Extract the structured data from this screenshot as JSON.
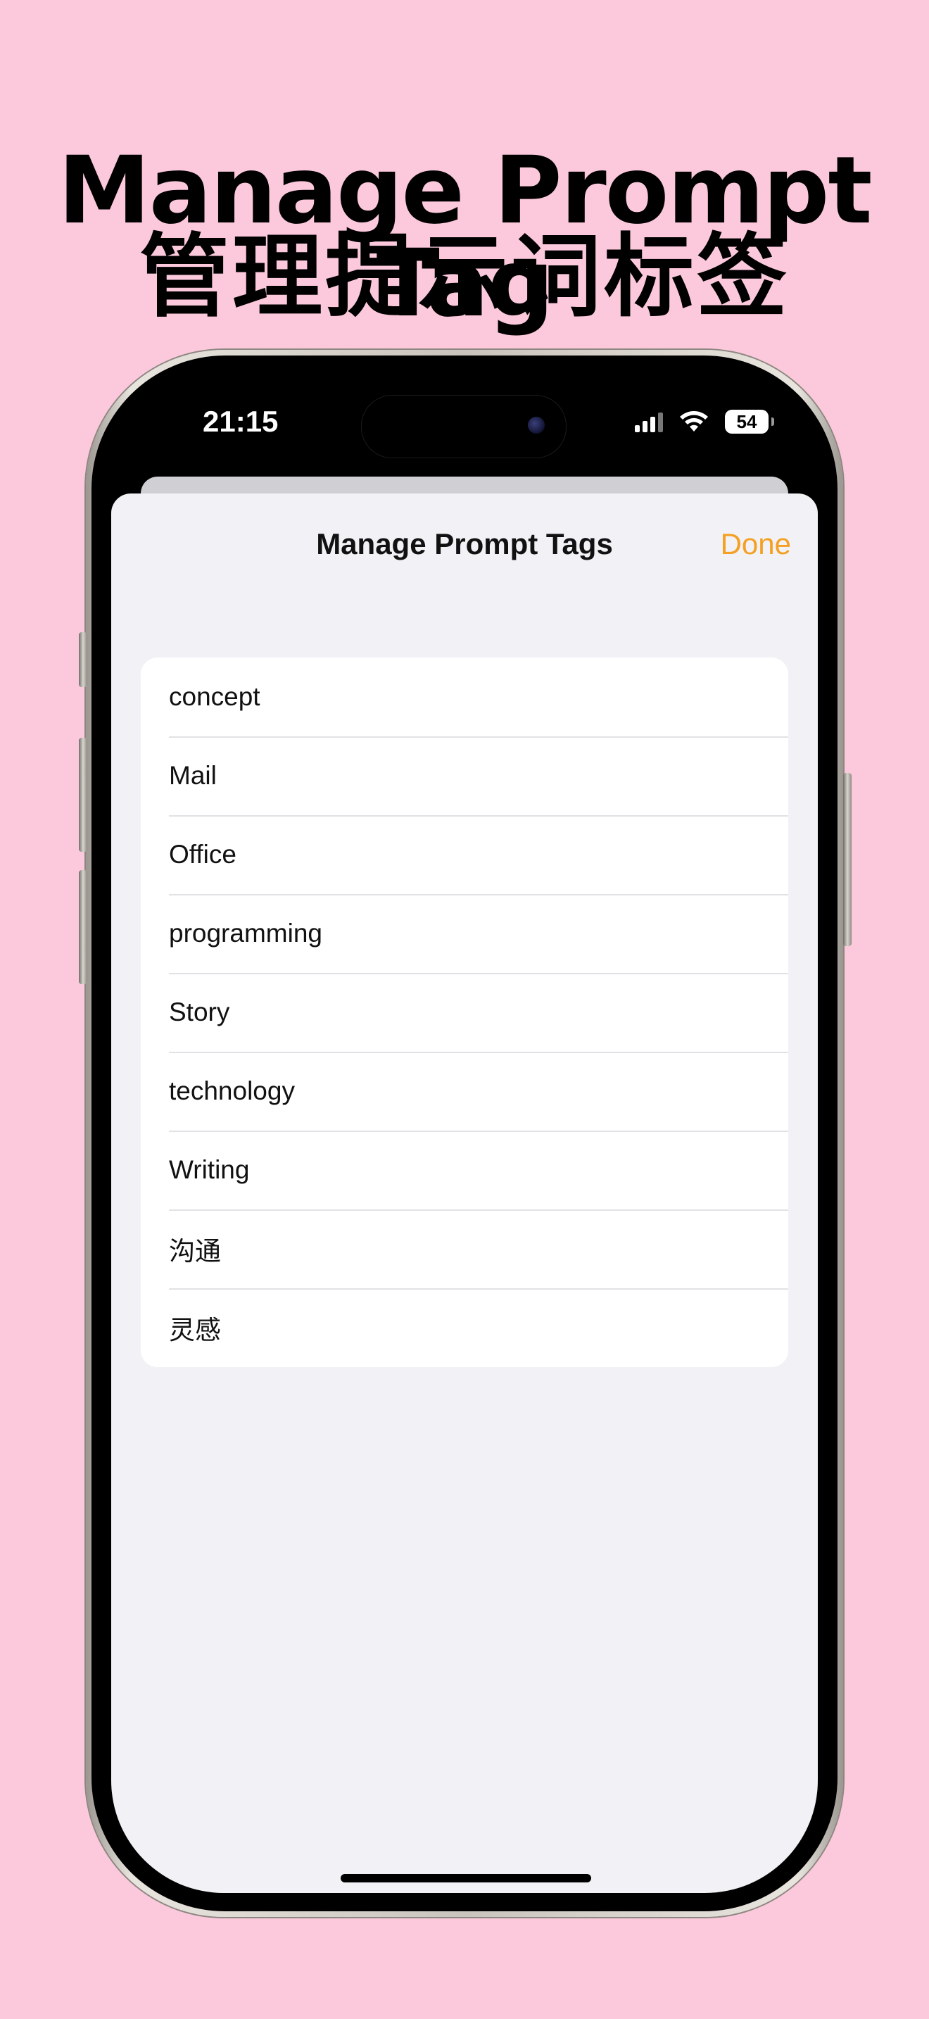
{
  "headline": {
    "english": "Manage Prompt Tag",
    "chinese": "管理提示词标签"
  },
  "status_bar": {
    "time": "21:15",
    "battery": "54",
    "icons": [
      "cellular-signal-icon",
      "wifi-icon",
      "battery-icon"
    ]
  },
  "sheet": {
    "title": "Manage Prompt Tags",
    "done_label": "Done",
    "accent_color": "#f4a022"
  },
  "tags": [
    "concept",
    "Mail",
    "Office",
    "programming",
    "Story",
    "technology",
    "Writing",
    "沟通",
    "灵感"
  ]
}
